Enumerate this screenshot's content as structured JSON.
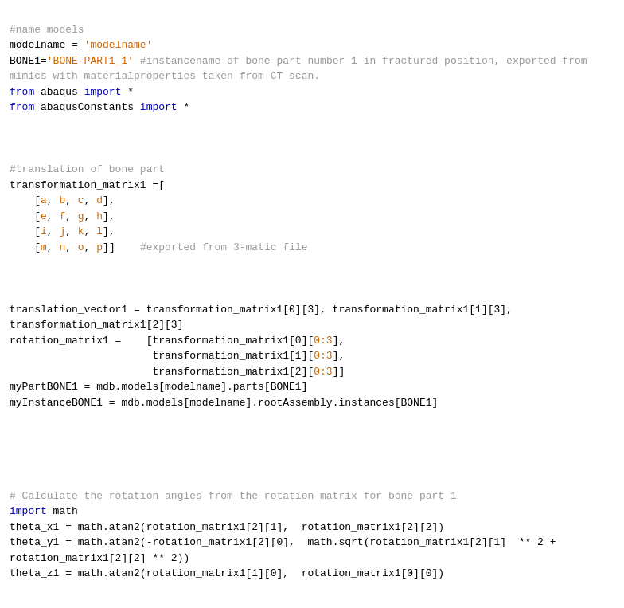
{
  "code": {
    "lines": []
  }
}
